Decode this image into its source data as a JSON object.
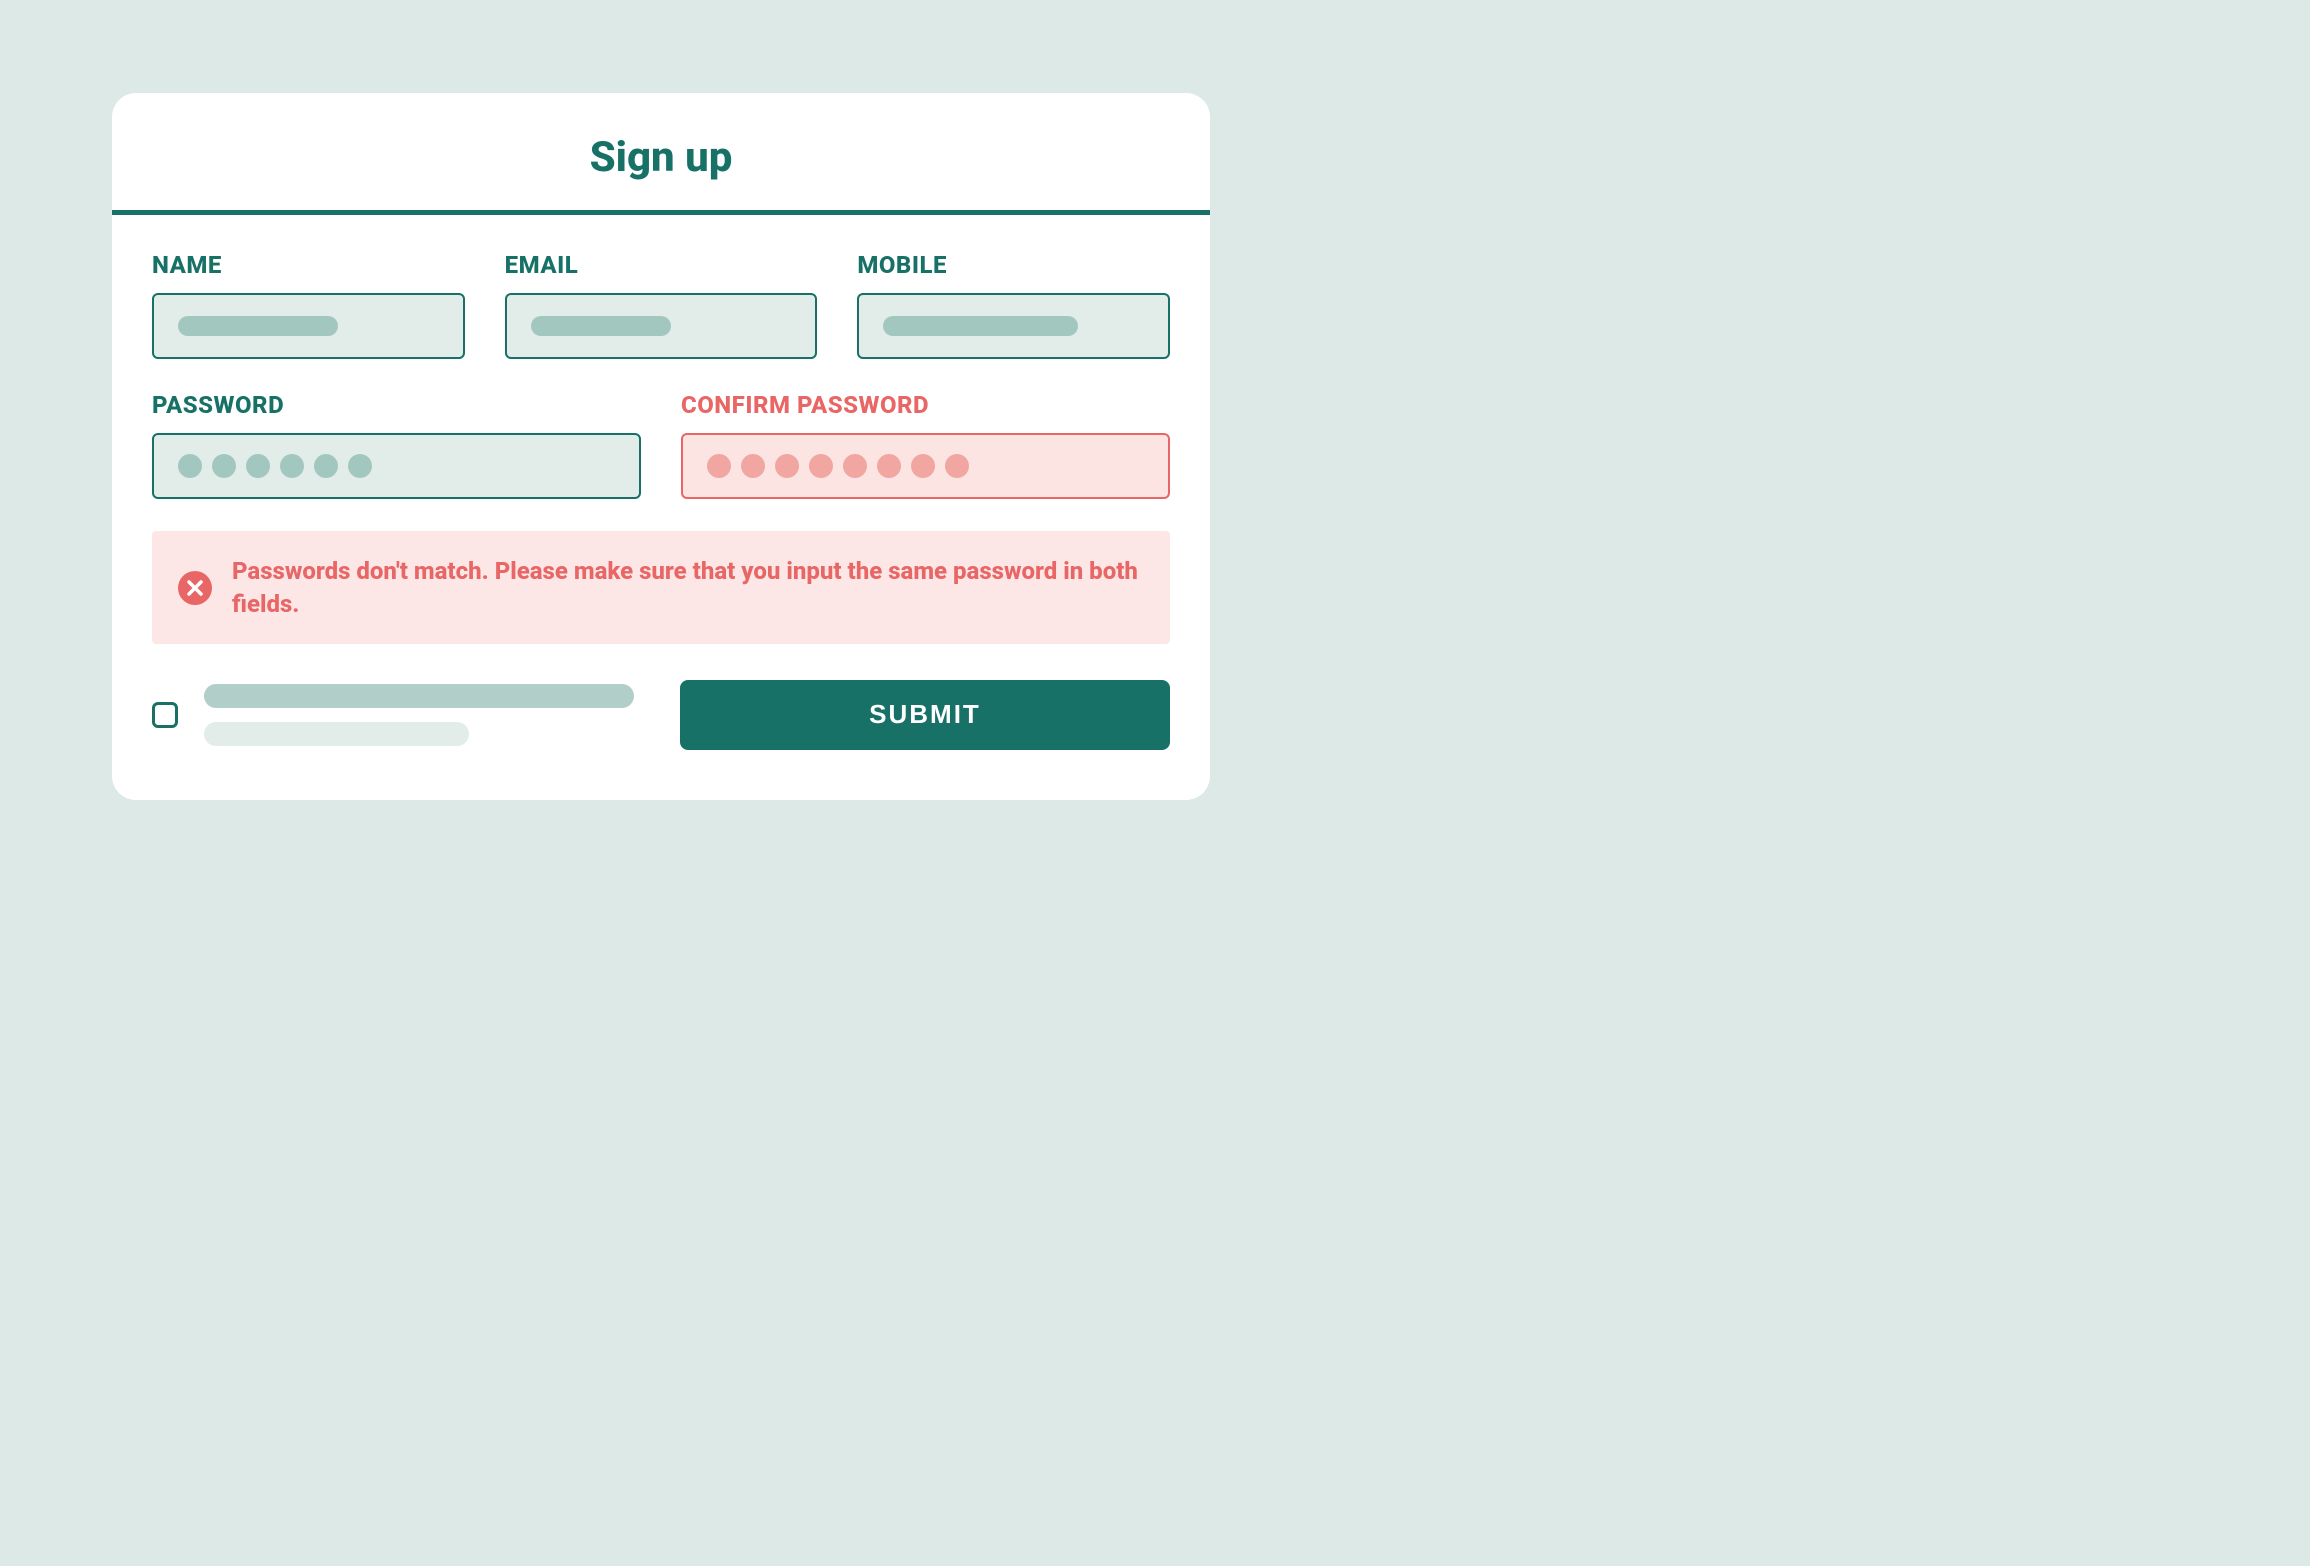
{
  "title": "Sign up",
  "fields": {
    "name": {
      "label": "NAME"
    },
    "email": {
      "label": "EMAIL"
    },
    "mobile": {
      "label": "MOBILE"
    },
    "password": {
      "label": "PASSWORD",
      "dots": 6
    },
    "confirm_password": {
      "label": "CONFIRM PASSWORD",
      "dots": 8
    }
  },
  "alert": {
    "message": "Passwords don't match. Please make sure that you input the same password in both fields."
  },
  "submit_label": "SUBMIT",
  "colors": {
    "primary": "#177167",
    "error": "#e86665",
    "input_bg": "#e2ece9",
    "error_bg": "#fce4e2"
  }
}
